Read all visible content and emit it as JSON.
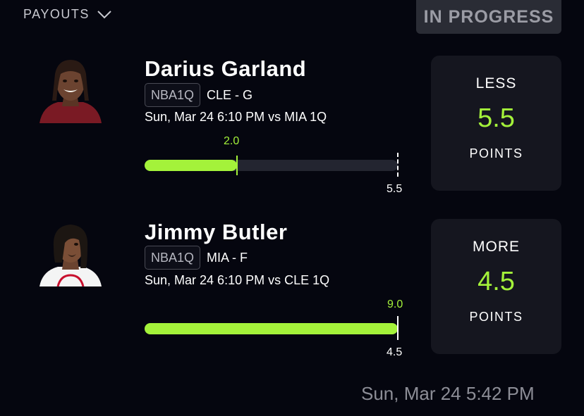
{
  "header": {
    "payouts_label": "PAYOUTS",
    "payouts_icon": "chevron-down-icon",
    "status": "IN PROGRESS"
  },
  "picks": [
    {
      "player": "Darius Garland",
      "league": "NBA1Q",
      "team_pos": "CLE - G",
      "game": "Sun, Mar 24 6:10 PM  vs MIA 1Q",
      "current": "2.0",
      "line": "5.5",
      "progress_fraction": 0.364,
      "direction": "LESS",
      "value": "5.5",
      "stat": "POINTS"
    },
    {
      "player": "Jimmy Butler",
      "league": "NBA1Q",
      "team_pos": "MIA - F",
      "game": "Sun, Mar 24 6:10 PM  vs CLE 1Q",
      "current": "9.0",
      "line": "4.5",
      "progress_fraction": 1.0,
      "direction": "MORE",
      "value": "4.5",
      "stat": "POINTS"
    }
  ],
  "footer": {
    "timestamp": "Sun, Mar 24 5:42 PM"
  },
  "colors": {
    "accent": "#a4f23a",
    "background": "#05060f",
    "card": "#15161f",
    "track": "#232530"
  }
}
